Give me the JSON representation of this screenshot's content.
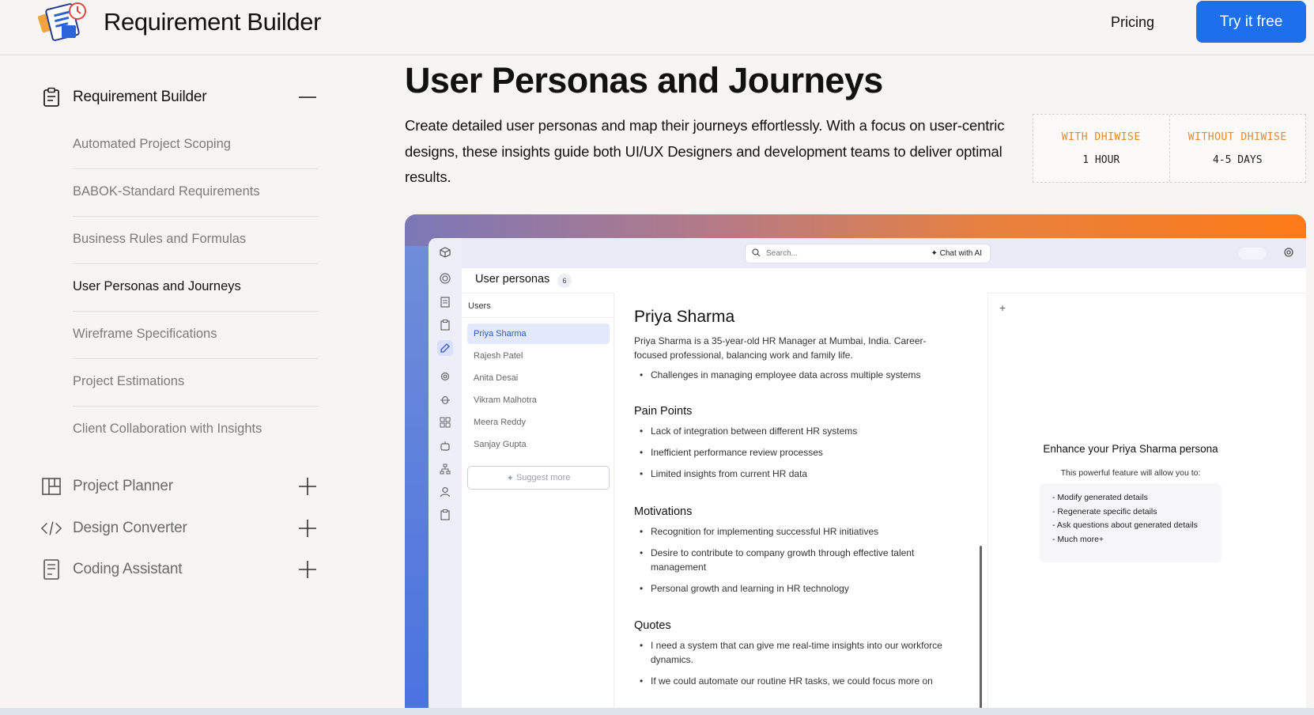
{
  "header": {
    "brand_name": "Requirement Builder",
    "pricing": "Pricing",
    "cta": "Try it free",
    "cta_color": "#1e6fee"
  },
  "sidebar": {
    "sections": [
      {
        "label": "Requirement Builder",
        "icon": "clipboard-icon",
        "expanded": true,
        "toggle": "—"
      },
      {
        "label": "Project Planner",
        "icon": "layout-grid-icon",
        "expanded": false,
        "toggle": "+"
      },
      {
        "label": "Design Converter",
        "icon": "code-icon",
        "expanded": false,
        "toggle": "+"
      },
      {
        "label": "Coding Assistant",
        "icon": "document-icon",
        "expanded": false,
        "toggle": "+"
      }
    ],
    "sub_items": [
      "Automated Project Scoping",
      "BABOK-Standard Requirements",
      "Business Rules and Formulas",
      "User Personas and Journeys",
      "Wireframe Specifications",
      "Project Estimations",
      "Client Collaboration with Insights"
    ],
    "active_sub_item": "User Personas and Journeys"
  },
  "main": {
    "title": "User Personas and Journeys",
    "description": "Create detailed user personas and map their journeys effortlessly. With a focus on user-centric designs, these insights guide both UI/UX Designers and development teams to deliver optimal results.",
    "stats": [
      {
        "label": "WITH DHIWISE",
        "value": "1 HOUR"
      },
      {
        "label": "WITHOUT DHIWISE",
        "value": "4-5 DAYS"
      }
    ],
    "stat_label_color": "#e4882a"
  },
  "preview": {
    "search_placeholder": "Search...",
    "chat_button": "Chat with AI",
    "personas_title": "User personas",
    "personas_count": "6",
    "users_label": "Users",
    "users": [
      "Priya Sharma",
      "Rajesh Patel",
      "Anita Desai",
      "Vikram Malhotra",
      "Meera Reddy",
      "Sanjay Gupta"
    ],
    "selected_user": "Priya Sharma",
    "suggest_more": "Suggest more",
    "persona": {
      "name": "Priya Sharma",
      "bio": "Priya Sharma is a 35-year-old HR Manager at Mumbai, India. Career-focused professional, balancing work and family life.",
      "challenges": [
        "Challenges in managing employee data across multiple systems"
      ],
      "pain_points_title": "Pain Points",
      "pain_points": [
        "Lack of integration between different HR systems",
        "Inefficient performance review processes",
        "Limited insights from current HR data"
      ],
      "motivations_title": "Motivations",
      "motivations": [
        "Recognition for implementing successful HR initiatives",
        "Desire to contribute to company growth through effective talent management",
        "Personal growth and learning in HR technology"
      ],
      "quotes_title": "Quotes",
      "quotes": [
        "I need a system that can give me real-time insights into our workforce dynamics.",
        "If we could automate our routine HR tasks, we could focus more on"
      ]
    },
    "enhance": {
      "title": "Enhance your Priya Sharma persona",
      "subtitle": "This powerful feature will allow you to:",
      "items": [
        "- Modify generated details",
        "- Regenerate specific details",
        "- Ask questions about generated details",
        "- Much more+"
      ]
    }
  }
}
